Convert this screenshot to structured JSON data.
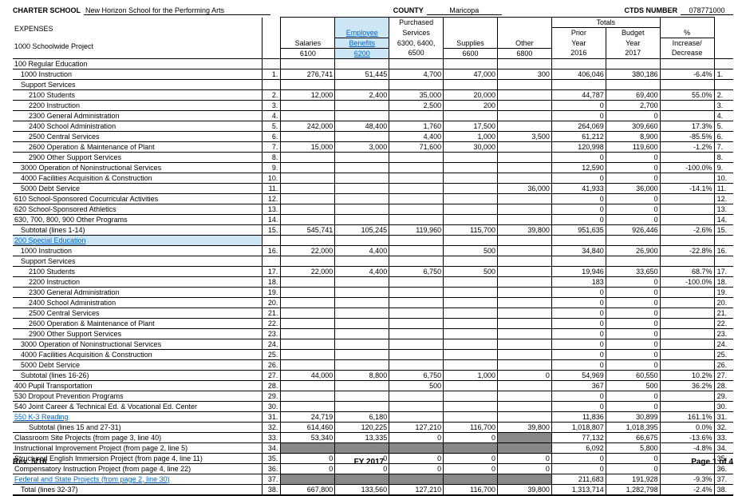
{
  "hdr": {
    "cs_l": "CHARTER SCHOOL",
    "cs_v": "New Horizon School for the Performing Arts",
    "cty_l": "COUNTY",
    "cty_v": "Maricopa",
    "ctds_l": "CTDS NUMBER",
    "ctds_v": "078771000"
  },
  "sec": {
    "exp": "EXPENSES",
    "proj": "1000 Schoolwide Project"
  },
  "cols": {
    "sal": "Salaries",
    "sal2": "6100",
    "ben": "Employee",
    "ben2": "Benefits",
    "ben3": "6200",
    "pur": "Purchased",
    "pur2": "Services",
    "pur3": "6300, 6400,",
    "pur4": "6500",
    "sup": "Supplies",
    "sup2": "6600",
    "oth": "Other",
    "oth2": "6800",
    "tot": "Totals",
    "py": "Prior",
    "py2": "Year",
    "py3": "2016",
    "by": "Budget",
    "by2": "Year",
    "by3": "2017",
    "pct": "%",
    "pct2": "Increase/",
    "pct3": "Decrease"
  },
  "r": [
    {
      "d": "100 Regular Education",
      "c": ""
    },
    {
      "d": "1000 Instruction",
      "c": "i1",
      "n": "1.",
      "v": [
        "276,741",
        "51,445",
        "4,700",
        "47,000",
        "300",
        "406,046",
        "380,186",
        "-6.4%"
      ],
      "rn": "1."
    },
    {
      "d": "Support Services",
      "c": "i1"
    },
    {
      "d": "2100 Students",
      "c": "i2",
      "n": "2.",
      "v": [
        "12,000",
        "2,400",
        "35,000",
        "20,000",
        "",
        "44,787",
        "69,400",
        "55.0%"
      ],
      "rn": "2."
    },
    {
      "d": "2200 Instruction",
      "c": "i2",
      "n": "3.",
      "v": [
        "",
        "",
        "2,500",
        "200",
        "",
        "0",
        "2,700",
        ""
      ],
      "rn": "3."
    },
    {
      "d": "2300 General Administration",
      "c": "i2",
      "n": "4.",
      "v": [
        "",
        "",
        "",
        "",
        "",
        "0",
        "0",
        ""
      ],
      "rn": "4."
    },
    {
      "d": "2400 School Administration",
      "c": "i2",
      "n": "5.",
      "v": [
        "242,000",
        "48,400",
        "1,760",
        "17,500",
        "",
        "264,069",
        "309,660",
        "17.3%"
      ],
      "rn": "5."
    },
    {
      "d": "2500 Central Services",
      "c": "i2",
      "n": "6.",
      "v": [
        "",
        "",
        "4,400",
        "1,000",
        "3,500",
        "61,212",
        "8,900",
        "-85.5%"
      ],
      "rn": "6."
    },
    {
      "d": "2600 Operation & Maintenance of Plant",
      "c": "i2",
      "n": "7.",
      "v": [
        "15,000",
        "3,000",
        "71,600",
        "30,000",
        "",
        "120,998",
        "119,600",
        "-1.2%"
      ],
      "rn": "7."
    },
    {
      "d": "2900 Other Support Services",
      "c": "i2",
      "n": "8.",
      "v": [
        "",
        "",
        "",
        "",
        "",
        "0",
        "0",
        ""
      ],
      "rn": "8."
    },
    {
      "d": "3000 Operation of Noninstructional Services",
      "c": "i1",
      "n": "9.",
      "v": [
        "",
        "",
        "",
        "",
        "",
        "12,590",
        "0",
        "-100.0%"
      ],
      "rn": "9."
    },
    {
      "d": "4000 Facilities Acquisition & Construction",
      "c": "i1",
      "n": "10.",
      "v": [
        "",
        "",
        "",
        "",
        "",
        "0",
        "0",
        ""
      ],
      "rn": "10."
    },
    {
      "d": "5000 Debt Service",
      "c": "i1",
      "n": "11.",
      "v": [
        "",
        "",
        "",
        "",
        "36,000",
        "41,933",
        "36,000",
        "-14.1%"
      ],
      "rn": "11."
    },
    {
      "d": "610 School-Sponsored Cocurricular Activities",
      "c": "",
      "n": "12.",
      "v": [
        "",
        "",
        "",
        "",
        "",
        "0",
        "0",
        ""
      ],
      "rn": "12."
    },
    {
      "d": "620 School-Sponsored Athletics",
      "c": "",
      "n": "13.",
      "v": [
        "",
        "",
        "",
        "",
        "",
        "0",
        "0",
        ""
      ],
      "rn": "13."
    },
    {
      "d": "630, 700, 800, 900 Other Programs",
      "c": "",
      "n": "14.",
      "v": [
        "",
        "",
        "",
        "",
        "",
        "0",
        "0",
        ""
      ],
      "rn": "14."
    },
    {
      "d": "Subtotal (lines 1-14)",
      "c": "i1",
      "n": "15.",
      "v": [
        "545,741",
        "105,245",
        "119,960",
        "115,700",
        "39,800",
        "951,635",
        "926,446",
        "-2.6%"
      ],
      "rn": "15."
    },
    {
      "d": "200 Special Education",
      "c": "",
      "bg": "bg-lblue",
      "hl": true
    },
    {
      "d": "1000 Instruction",
      "c": "i1",
      "n": "16.",
      "v": [
        "22,000",
        "4,400",
        "",
        "500",
        "",
        "34,840",
        "26,900",
        "-22.8%"
      ],
      "rn": "16."
    },
    {
      "d": "Support Services",
      "c": "i1"
    },
    {
      "d": "2100 Students",
      "c": "i2",
      "n": "17.",
      "v": [
        "22,000",
        "4,400",
        "6,750",
        "500",
        "",
        "19,946",
        "33,650",
        "68.7%"
      ],
      "rn": "17."
    },
    {
      "d": "2200 Instruction",
      "c": "i2",
      "n": "18.",
      "v": [
        "",
        "",
        "",
        "",
        "",
        "183",
        "0",
        "-100.0%"
      ],
      "rn": "18."
    },
    {
      "d": "2300 General Administration",
      "c": "i2",
      "n": "19.",
      "v": [
        "",
        "",
        "",
        "",
        "",
        "0",
        "0",
        ""
      ],
      "rn": "19."
    },
    {
      "d": "2400 School Administration",
      "c": "i2",
      "n": "20.",
      "v": [
        "",
        "",
        "",
        "",
        "",
        "0",
        "0",
        ""
      ],
      "rn": "20."
    },
    {
      "d": "2500 Central Services",
      "c": "i2",
      "n": "21.",
      "v": [
        "",
        "",
        "",
        "",
        "",
        "0",
        "0",
        ""
      ],
      "rn": "21."
    },
    {
      "d": "2600 Operation & Maintenance of Plant",
      "c": "i2",
      "n": "22.",
      "v": [
        "",
        "",
        "",
        "",
        "",
        "0",
        "0",
        ""
      ],
      "rn": "22."
    },
    {
      "d": "2900 Other Support Services",
      "c": "i2",
      "n": "23.",
      "v": [
        "",
        "",
        "",
        "",
        "",
        "0",
        "0",
        ""
      ],
      "rn": "23."
    },
    {
      "d": "3000 Operation of Noninstructional Services",
      "c": "i1",
      "n": "24.",
      "v": [
        "",
        "",
        "",
        "",
        "",
        "0",
        "0",
        ""
      ],
      "rn": "24."
    },
    {
      "d": "4000 Facilities Acquisition & Construction",
      "c": "i1",
      "n": "25.",
      "v": [
        "",
        "",
        "",
        "",
        "",
        "0",
        "0",
        ""
      ],
      "rn": "25."
    },
    {
      "d": "5000 Debt Service",
      "c": "i1",
      "n": "26.",
      "v": [
        "",
        "",
        "",
        "",
        "",
        "0",
        "0",
        ""
      ],
      "rn": "26."
    },
    {
      "d": "Subtotal (lines 16-26)",
      "c": "i1",
      "n": "27.",
      "v": [
        "44,000",
        "8,800",
        "6,750",
        "1,000",
        "0",
        "54,969",
        "60,550",
        "10.2%"
      ],
      "rn": "27."
    },
    {
      "d": "400 Pupil Transportation",
      "c": "",
      "n": "28.",
      "v": [
        "",
        "",
        "500",
        "",
        "",
        "367",
        "500",
        "36.2%"
      ],
      "rn": "28."
    },
    {
      "d": "530 Dropout Prevention Programs",
      "c": "",
      "n": "29.",
      "v": [
        "",
        "",
        "",
        "",
        "",
        "0",
        "0",
        ""
      ],
      "rn": "29."
    },
    {
      "d": "540 Joint Career & Technical Ed. & Vocational Ed. Center",
      "c": "",
      "n": "30.",
      "v": [
        "",
        "",
        "",
        "",
        "",
        "0",
        "0",
        ""
      ],
      "rn": "30."
    },
    {
      "d": "550 K-3 Reading",
      "c": "",
      "n": "31.",
      "v": [
        "24,719",
        "6,180",
        "",
        "",
        "",
        "11,836",
        "30,899",
        "161.1%"
      ],
      "rn": "31.",
      "hl": true
    },
    {
      "d": "Subtotal (lines 15 and 27-31)",
      "c": "i2",
      "n": "32.",
      "v": [
        "614,460",
        "120,225",
        "127,210",
        "116,700",
        "39,800",
        "1,018,807",
        "1,018,395",
        "0.0%"
      ],
      "rn": "32."
    },
    {
      "d": "Classroom Site Projects (from page 3, line 40)",
      "c": "",
      "n": "33.",
      "v": [
        "53,340",
        "13,335",
        "0",
        "0",
        "",
        "77,132",
        "66,675",
        "-13.6%"
      ],
      "rn": "33.",
      "g": [
        4
      ]
    },
    {
      "d": "Instructional Improvement Project (from page 2, line 5)",
      "c": "",
      "n": "34.",
      "v": [
        "",
        "",
        "",
        "",
        "",
        "6,092",
        "5,800",
        "-4.8%"
      ],
      "rn": "34.",
      "g": [
        0,
        1,
        2,
        3,
        4
      ]
    },
    {
      "d": "Structured English Immersion Project (from page 4, line 11)",
      "c": "",
      "n": "35.",
      "v": [
        "0",
        "0",
        "0",
        "0",
        "0",
        "0",
        "0",
        ""
      ],
      "rn": "35."
    },
    {
      "d": "Compensatory Instruction Project (from page 4, line 22)",
      "c": "",
      "n": "36.",
      "v": [
        "0",
        "0",
        "0",
        "0",
        "0",
        "0",
        "0",
        ""
      ],
      "rn": "36."
    },
    {
      "d": "Federal and State Projects (from page 2, line 30)",
      "c": "",
      "n": "37.",
      "v": [
        "",
        "",
        "",
        "",
        "",
        "211,683",
        "191,928",
        "-9.3%"
      ],
      "rn": "37.",
      "hl": true,
      "g": [
        0,
        1,
        2,
        3,
        4
      ]
    },
    {
      "d": "Total (lines 32-37)",
      "c": "i1",
      "n": "38.",
      "v": [
        "667,800",
        "133,560",
        "127,210",
        "116,700",
        "39,800",
        "1,313,714",
        "1,282,798",
        "-2.4%"
      ],
      "rn": "38."
    }
  ],
  "ftr": {
    "l": "Rev. 5/16",
    "c": "FY 2017",
    "r": "Page  1 of 4"
  }
}
